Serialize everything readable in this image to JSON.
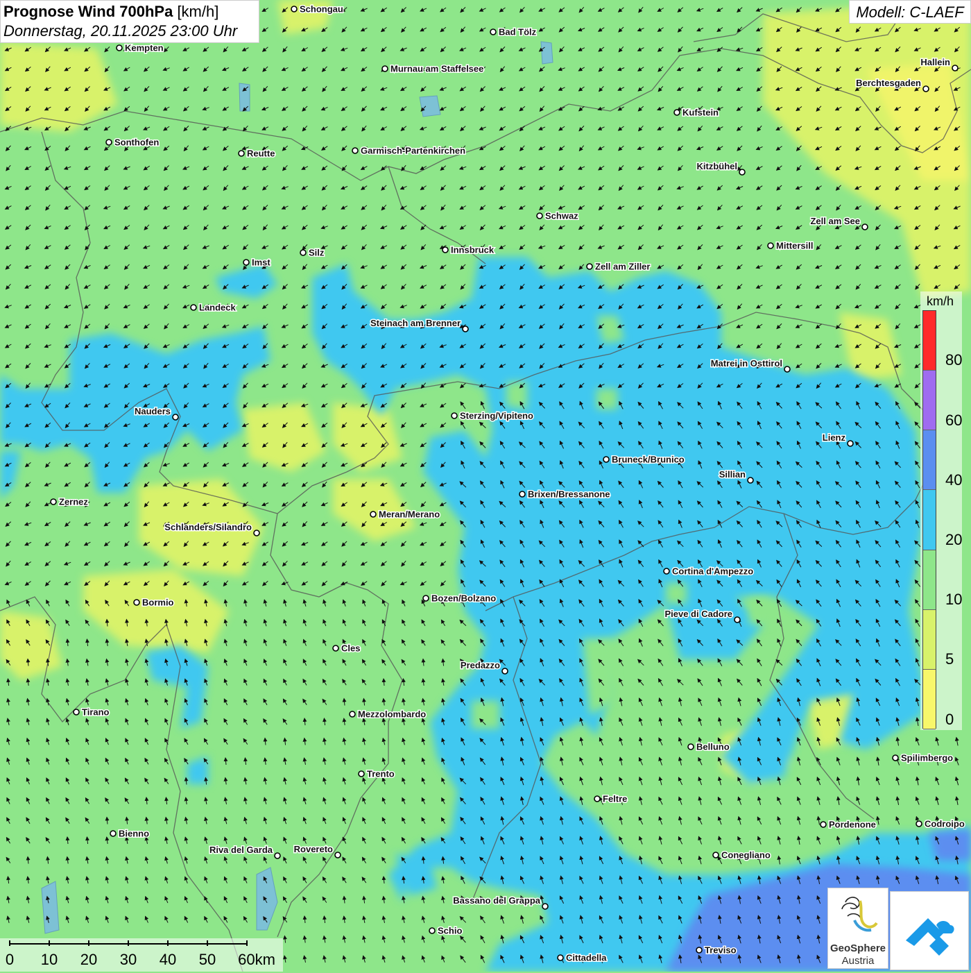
{
  "title": {
    "bold": "Prognose Wind 700hPa",
    "unit": "[km/h]",
    "datetime": "Donnerstag, 20.11.2025 23:00 Uhr"
  },
  "model": "Modell: C-LAEF",
  "legend": {
    "unit": "km/h",
    "labels": [
      "80",
      "60",
      "40",
      "20",
      "10",
      "5",
      "0"
    ],
    "colors": [
      "#ff2a2a",
      "#9f6cf0",
      "#5b8ef0",
      "#40c8f0",
      "#8ee68a",
      "#d8f26a",
      "#f8f76a"
    ]
  },
  "scalebar": {
    "labels": [
      "0",
      "10",
      "20",
      "30",
      "40",
      "50",
      "60km"
    ]
  },
  "logos": {
    "geosphere_line1": "GeoSphere",
    "geosphere_line2": "Austria"
  },
  "colors": {
    "wind_0_5": "#f8f76a",
    "wind_5_10": "#d8f26a",
    "wind_10_20": "#8ee68a",
    "wind_20_40": "#40c8f0",
    "wind_40_60": "#5b8ef0"
  },
  "cities": [
    {
      "name": "Schongau"
    },
    {
      "name": "Bad Tölz"
    },
    {
      "name": "Kempten"
    },
    {
      "name": "Murnau am Staffelsee"
    },
    {
      "name": "Hallein"
    },
    {
      "name": "Berchtesgaden"
    },
    {
      "name": "Kufstein"
    },
    {
      "name": "Sonthofen"
    },
    {
      "name": "Reutte"
    },
    {
      "name": "Garmisch-Partenkirchen"
    },
    {
      "name": "Kitzbühel"
    },
    {
      "name": "Schwaz"
    },
    {
      "name": "Zell am See"
    },
    {
      "name": "Mittersill"
    },
    {
      "name": "Imst"
    },
    {
      "name": "Silz"
    },
    {
      "name": "Innsbruck"
    },
    {
      "name": "Zell am Ziller"
    },
    {
      "name": "Landeck"
    },
    {
      "name": "Steinach am Brenner"
    },
    {
      "name": "Matrei in Osttirol"
    },
    {
      "name": "Nauders"
    },
    {
      "name": "Sterzing/Vipiteno"
    },
    {
      "name": "Lienz"
    },
    {
      "name": "Bruneck/Brunico"
    },
    {
      "name": "Sillian"
    },
    {
      "name": "Brixen/Bressanone"
    },
    {
      "name": "Zernez"
    },
    {
      "name": "Meran/Merano"
    },
    {
      "name": "Schlanders/Silandro"
    },
    {
      "name": "Cortina d'Ampezzo"
    },
    {
      "name": "Bozen/Bolzano"
    },
    {
      "name": "Bormio"
    },
    {
      "name": "Pieve di Cadore"
    },
    {
      "name": "Cles"
    },
    {
      "name": "Predazzo"
    },
    {
      "name": "Tirano"
    },
    {
      "name": "Mezzolombardo"
    },
    {
      "name": "Belluno"
    },
    {
      "name": "Spilimbergo"
    },
    {
      "name": "Trento"
    },
    {
      "name": "Feltre"
    },
    {
      "name": "Pordenone"
    },
    {
      "name": "Codroipo"
    },
    {
      "name": "Bienno"
    },
    {
      "name": "Riva del Garda"
    },
    {
      "name": "Rovereto"
    },
    {
      "name": "Conegliano"
    },
    {
      "name": "Bassano del Grappa"
    },
    {
      "name": "Schio"
    },
    {
      "name": "Treviso"
    },
    {
      "name": "Cittadella"
    }
  ]
}
